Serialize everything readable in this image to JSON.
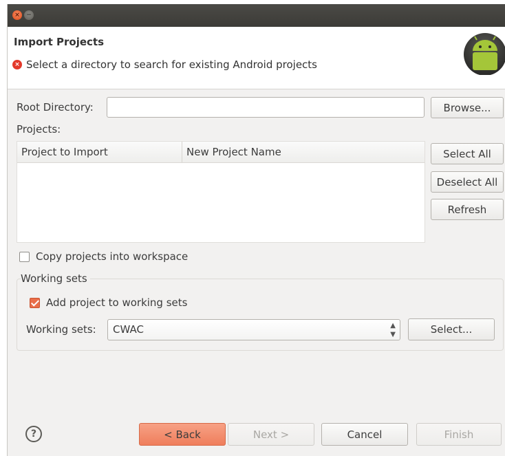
{
  "window": {
    "close_glyph": "×",
    "min_glyph": "−"
  },
  "header": {
    "title": "Import Projects",
    "message": "Select a directory to search for existing Android projects",
    "error_glyph": "×"
  },
  "root_directory": {
    "label": "Root Directory:",
    "value": "",
    "browse_label": "Browse..."
  },
  "projects": {
    "label": "Projects:",
    "columns": [
      "Project to Import",
      "New Project Name"
    ],
    "rows": [],
    "select_all_label": "Select All",
    "deselect_all_label": "Deselect All",
    "refresh_label": "Refresh"
  },
  "copy_into_workspace": {
    "label": "Copy projects into workspace",
    "checked": false
  },
  "working_sets": {
    "group_title": "Working sets",
    "add_label": "Add project to working sets",
    "add_checked": true,
    "select_label": "Working sets:",
    "selected_value": "CWAC",
    "select_button_label": "Select..."
  },
  "footer": {
    "help_glyph": "?",
    "back_label": "< Back",
    "next_label": "Next >",
    "cancel_label": "Cancel",
    "finish_label": "Finish"
  },
  "colors": {
    "accent": "#ef7e5c",
    "error": "#e3392a",
    "titlebar": "#3c3b37",
    "android_green": "#a4c639"
  }
}
